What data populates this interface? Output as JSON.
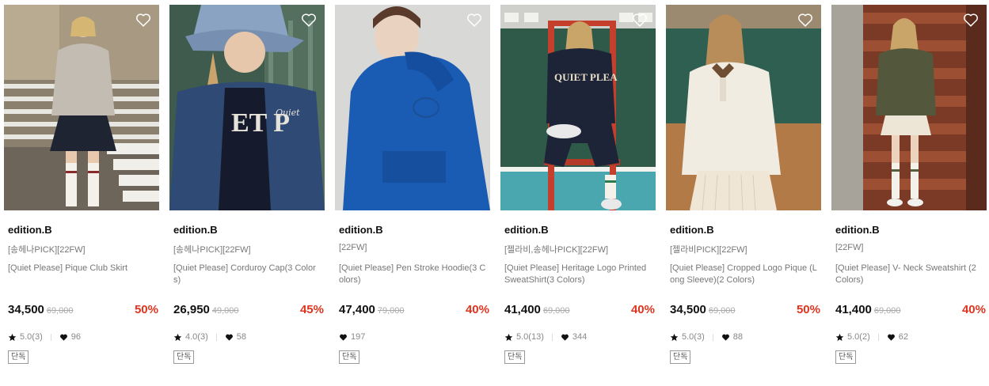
{
  "colors": {
    "discount": "#e0341f",
    "text_primary": "#111111",
    "text_secondary": "#777777",
    "strike": "#aaaaaa"
  },
  "products": [
    {
      "brand": "edition.B",
      "tag": "[송헤나PICK][22FW]",
      "name": "[Quiet Please] Pique Club Skirt",
      "price": "34,500",
      "original": "69,000",
      "discount": "50%",
      "rating": "5.0(3)",
      "likes": "96",
      "badge": "단독",
      "wishlist_icon": "heart-outline-icon"
    },
    {
      "brand": "edition.B",
      "tag": "[송헤나PICK][22FW]",
      "name": "[Quiet Please] Corduroy Cap(3 Colors)",
      "price": "26,950",
      "original": "49,000",
      "discount": "45%",
      "rating": "4.0(3)",
      "likes": "58",
      "badge": "단독",
      "wishlist_icon": "heart-outline-icon"
    },
    {
      "brand": "edition.B",
      "tag": "[22FW]",
      "name": "[Quiet Please] Pen Stroke Hoodie(3 Colors)",
      "price": "47,400",
      "original": "79,000",
      "discount": "40%",
      "rating": "",
      "likes": "197",
      "badge": "단독",
      "wishlist_icon": "heart-outline-icon"
    },
    {
      "brand": "edition.B",
      "tag": "[젤라비,송헤나PICK][22FW]",
      "name": "[Quiet Please] Heritage Logo Printed SweatShirt(3 Colors)",
      "price": "41,400",
      "original": "69,000",
      "discount": "40%",
      "rating": "5.0(13)",
      "likes": "344",
      "badge": "단독",
      "wishlist_icon": "heart-outline-icon"
    },
    {
      "brand": "edition.B",
      "tag": "[젤라비PICK][22FW]",
      "name": "[Quiet Please] Cropped Logo Pique (Long Sleeve)(2 Colors)",
      "price": "34,500",
      "original": "69,000",
      "discount": "50%",
      "rating": "5.0(3)",
      "likes": "88",
      "badge": "단독",
      "wishlist_icon": "heart-outline-icon"
    },
    {
      "brand": "edition.B",
      "tag": "[22FW]",
      "name": "[Quiet Please] V- Neck Sweatshirt (2 Colors)",
      "price": "41,400",
      "original": "69,000",
      "discount": "40%",
      "rating": "5.0(2)",
      "likes": "62",
      "badge": "단독",
      "wishlist_icon": "heart-outline-icon"
    }
  ]
}
